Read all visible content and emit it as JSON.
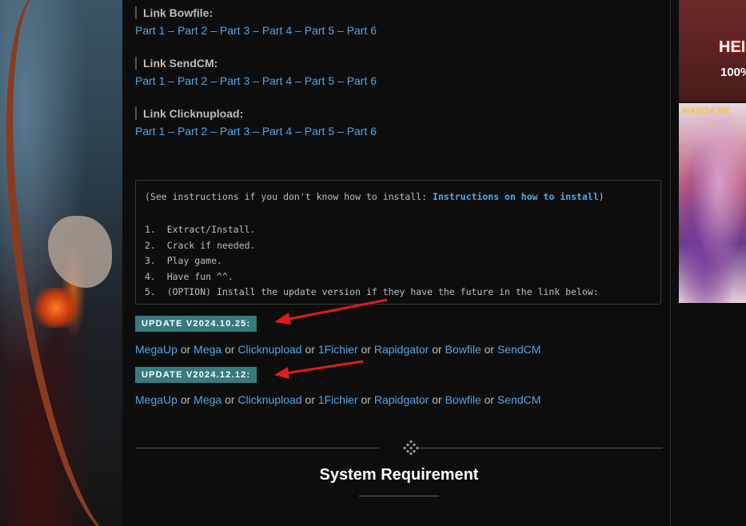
{
  "link_groups": [
    {
      "title": "Link Bowfile:",
      "parts": [
        "Part 1",
        "Part 2",
        "Part 3",
        "Part 4",
        "Part 5",
        "Part 6"
      ]
    },
    {
      "title": "Link SendCM:",
      "parts": [
        "Part 1",
        "Part 2",
        "Part 3",
        "Part 4",
        "Part 5",
        "Part 6"
      ]
    },
    {
      "title": "Link Clicknupload:",
      "parts": [
        "Part 1",
        "Part 2",
        "Part 3",
        "Part 4",
        "Part 5",
        "Part 6"
      ]
    }
  ],
  "part_separator": "–",
  "instructions": {
    "prefix": "(See instructions if you don't know how to install: ",
    "link": "Instructions on how to install",
    "suffix": ")",
    "steps": [
      "1.  Extract/Install.",
      "2.  Crack if needed.",
      "3.  Play game.",
      "4.  Have fun ^^.",
      "5.  (OPTION) Install the update version if they have the future in the link below:"
    ]
  },
  "updates": [
    {
      "label": "UPDATE V2024.10.25:",
      "hosts": [
        "MegaUp",
        "Mega",
        "Clicknupload",
        "1Fichier",
        "Rapidgator",
        "Bowfile",
        "SendCM"
      ]
    },
    {
      "label": "UPDATE V2024.12.12:",
      "hosts": [
        "MegaUp",
        "Mega",
        "Clicknupload",
        "1Fichier",
        "Rapidgator",
        "Bowfile",
        "SendCM"
      ]
    }
  ],
  "host_separator": "or",
  "section_title": "System Requirement",
  "sidebar_ads": {
    "top_line1": "HEI",
    "top_line2": "100%",
    "bottom_logo": "MANGA RE"
  },
  "colors": {
    "link": "#4fa6e8",
    "badge": "#377b7f",
    "arrow": "#e01b1b"
  }
}
